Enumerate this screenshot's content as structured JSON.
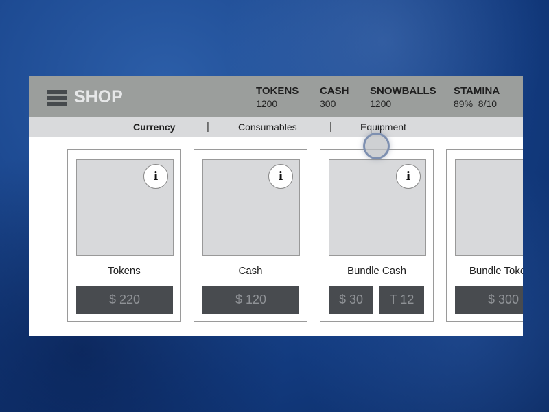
{
  "header": {
    "title": "SHOP",
    "menu_icon": "hamburger-menu-icon",
    "stats": [
      {
        "label": "TOKENS",
        "value": "1200"
      },
      {
        "label": "CASH",
        "value": "300"
      },
      {
        "label": "SNOWBALLS",
        "value": "1200"
      },
      {
        "label": "STAMINA",
        "value": "89%  8/10"
      }
    ]
  },
  "tabs": [
    {
      "label": "Currency",
      "active": true
    },
    {
      "label": "Consumables"
    },
    {
      "label": "Equipment"
    }
  ],
  "tab_separator": "|",
  "info_label": "i",
  "cards": [
    {
      "name": "Tokens",
      "prices": [
        "$ 220"
      ]
    },
    {
      "name": "Cash",
      "prices": [
        "$ 120"
      ]
    },
    {
      "name": "Bundle Cash",
      "prices": [
        "$ 30",
        "T 12"
      ]
    },
    {
      "name": "Bundle Tokens",
      "prices": [
        "$ 300"
      ]
    }
  ]
}
